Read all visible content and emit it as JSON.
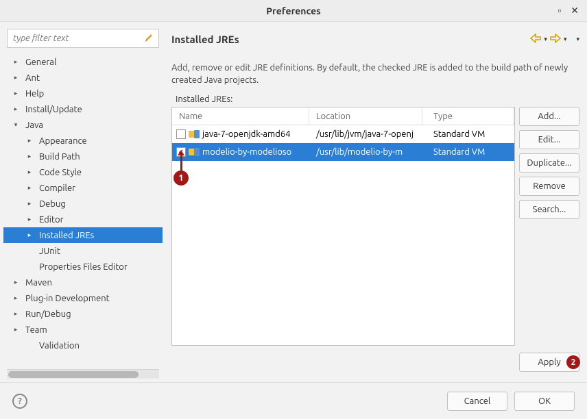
{
  "window_title": "Preferences",
  "filter_placeholder": "type filter text",
  "tree": {
    "items": [
      {
        "label": "General",
        "indent": 0,
        "expandable": true,
        "expanded": false
      },
      {
        "label": "Ant",
        "indent": 0,
        "expandable": true,
        "expanded": false
      },
      {
        "label": "Help",
        "indent": 0,
        "expandable": true,
        "expanded": false
      },
      {
        "label": "Install/Update",
        "indent": 0,
        "expandable": true,
        "expanded": false
      },
      {
        "label": "Java",
        "indent": 0,
        "expandable": true,
        "expanded": true
      },
      {
        "label": "Appearance",
        "indent": 1,
        "expandable": true,
        "expanded": false
      },
      {
        "label": "Build Path",
        "indent": 1,
        "expandable": true,
        "expanded": false
      },
      {
        "label": "Code Style",
        "indent": 1,
        "expandable": true,
        "expanded": false
      },
      {
        "label": "Compiler",
        "indent": 1,
        "expandable": true,
        "expanded": false
      },
      {
        "label": "Debug",
        "indent": 1,
        "expandable": true,
        "expanded": false
      },
      {
        "label": "Editor",
        "indent": 1,
        "expandable": true,
        "expanded": false
      },
      {
        "label": "Installed JREs",
        "indent": 1,
        "expandable": true,
        "expanded": false,
        "selected": true
      },
      {
        "label": "JUnit",
        "indent": 1,
        "expandable": false,
        "expanded": false
      },
      {
        "label": "Properties Files Editor",
        "indent": 1,
        "expandable": false,
        "expanded": false
      },
      {
        "label": "Maven",
        "indent": 0,
        "expandable": true,
        "expanded": false
      },
      {
        "label": "Plug-in Development",
        "indent": 0,
        "expandable": true,
        "expanded": false
      },
      {
        "label": "Run/Debug",
        "indent": 0,
        "expandable": true,
        "expanded": false
      },
      {
        "label": "Team",
        "indent": 0,
        "expandable": true,
        "expanded": false
      },
      {
        "label": "Validation",
        "indent": 1,
        "expandable": false,
        "expanded": false
      }
    ]
  },
  "page": {
    "title": "Installed JREs",
    "description": "Add, remove or edit JRE definitions. By default, the checked JRE is added to the build path of newly created Java projects.",
    "table_label": "Installed JREs:",
    "columns": {
      "name": "Name",
      "location": "Location",
      "type": "Type"
    },
    "rows": [
      {
        "checked": false,
        "name": "java-7-openjdk-amd64",
        "location": "/usr/lib/jvm/java-7-openj",
        "type": "Standard VM",
        "selected": false
      },
      {
        "checked": true,
        "name": "modelio-by-modelioso",
        "location": "/usr/lib/modelio-by-m",
        "type": "Standard VM",
        "selected": true
      }
    ],
    "buttons": {
      "add": "Add...",
      "edit": "Edit...",
      "duplicate": "Duplicate...",
      "remove": "Remove",
      "search": "Search...",
      "apply": "Apply"
    }
  },
  "footer": {
    "cancel": "Cancel",
    "ok": "OK"
  },
  "markers": {
    "one": "1",
    "two": "2"
  }
}
